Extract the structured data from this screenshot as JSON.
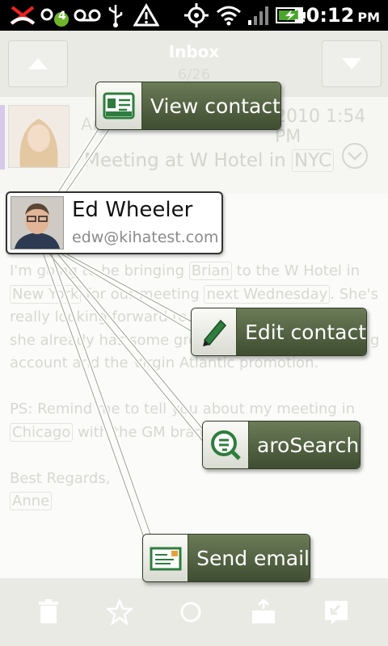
{
  "status_bar": {
    "notification_badge": "4",
    "time": "10:12",
    "ampm": "PM",
    "icons": [
      "missed-call-icon",
      "voicemail-badge-icon",
      "voicemail-icon",
      "usb-icon",
      "warning-icon",
      "gps-icon",
      "wifi-icon",
      "signal-icon",
      "battery-charging-icon"
    ]
  },
  "nav": {
    "title": "Inbox",
    "count": "6/26"
  },
  "email": {
    "sender_name": "Anne Sanford",
    "date": "2010 1:54 PM",
    "subject_prefix": "Meeting at W Hotel in ",
    "subject_highlight": "NYC",
    "body": {
      "l1a": "I'm going to be bringing ",
      "l1b": "Brian",
      "l1c": " to the W Hotel in",
      "l2a": "New York",
      "l2b": " for our meeting ",
      "l2c": "next Wednesday",
      "l2d": ". She's",
      "l3": "really looking forward to",
      "l4": "she already has some gre",
      "l4b": "g",
      "l5": "account and the Virgin Atlantic promotion.",
      "l6": "PS: Remind me to tell you about my meeting in",
      "l7a": "Chicago",
      "l7b": " with the GM brand",
      "l8": "Best Regards,",
      "l9": "Anne"
    }
  },
  "contact": {
    "name": "Ed Wheeler",
    "email": "edw@kihatest.com"
  },
  "actions": {
    "view_contact": "View contact",
    "edit_contact": "Edit contact",
    "arosearch": "aroSearch",
    "send_email": "Send email"
  },
  "bottom_bar": {
    "icons": [
      "trash-icon",
      "star-icon",
      "circle-icon",
      "archive-icon",
      "reply-icon"
    ]
  },
  "colors": {
    "action_green": "#55653f",
    "accent_purple": "#d8c9ea"
  }
}
